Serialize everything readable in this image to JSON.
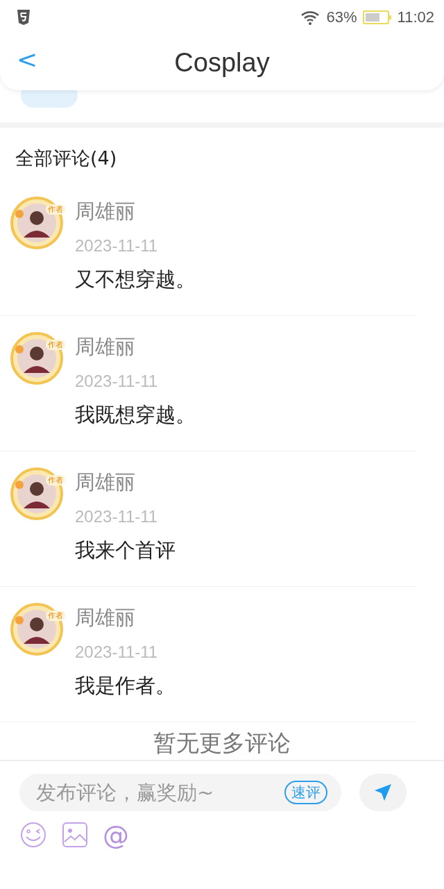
{
  "status_bar": {
    "battery": "63%",
    "time": "11:02"
  },
  "header": {
    "back": "<",
    "title": "Cosplay"
  },
  "comments_heading": "全部评论(4)",
  "comments": [
    {
      "name": "周雄丽",
      "badge": "作者",
      "date": "2023-11-11",
      "text": "又不想穿越。"
    },
    {
      "name": "周雄丽",
      "badge": "作者",
      "date": "2023-11-11",
      "text": "我既想穿越。"
    },
    {
      "name": "周雄丽",
      "badge": "作者",
      "date": "2023-11-11",
      "text": "我来个首评"
    },
    {
      "name": "周雄丽",
      "badge": "作者",
      "date": "2023-11-11",
      "text": "我是作者。"
    }
  ],
  "end_note": "暂无更多评论",
  "composer": {
    "placeholder": "发布评论，赢奖励~",
    "quick": "速评",
    "at": "@"
  }
}
